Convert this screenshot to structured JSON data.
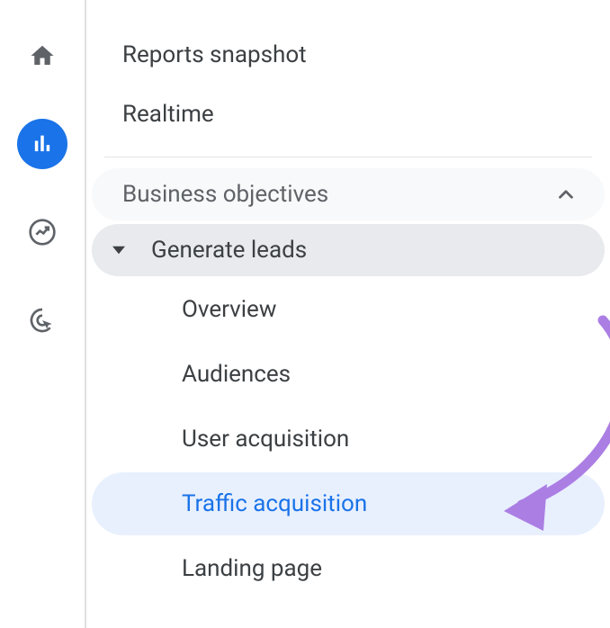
{
  "nav": {
    "reports_snapshot": "Reports snapshot",
    "realtime": "Realtime"
  },
  "section": {
    "title": "Business objectives"
  },
  "group": {
    "title": "Generate leads"
  },
  "items": {
    "overview": "Overview",
    "audiences": "Audiences",
    "user_acquisition": "User acquisition",
    "traffic_acquisition": "Traffic acquisition",
    "landing_page": "Landing page"
  },
  "colors": {
    "accent": "#1a73e8",
    "annotation": "#ab7ee4"
  }
}
